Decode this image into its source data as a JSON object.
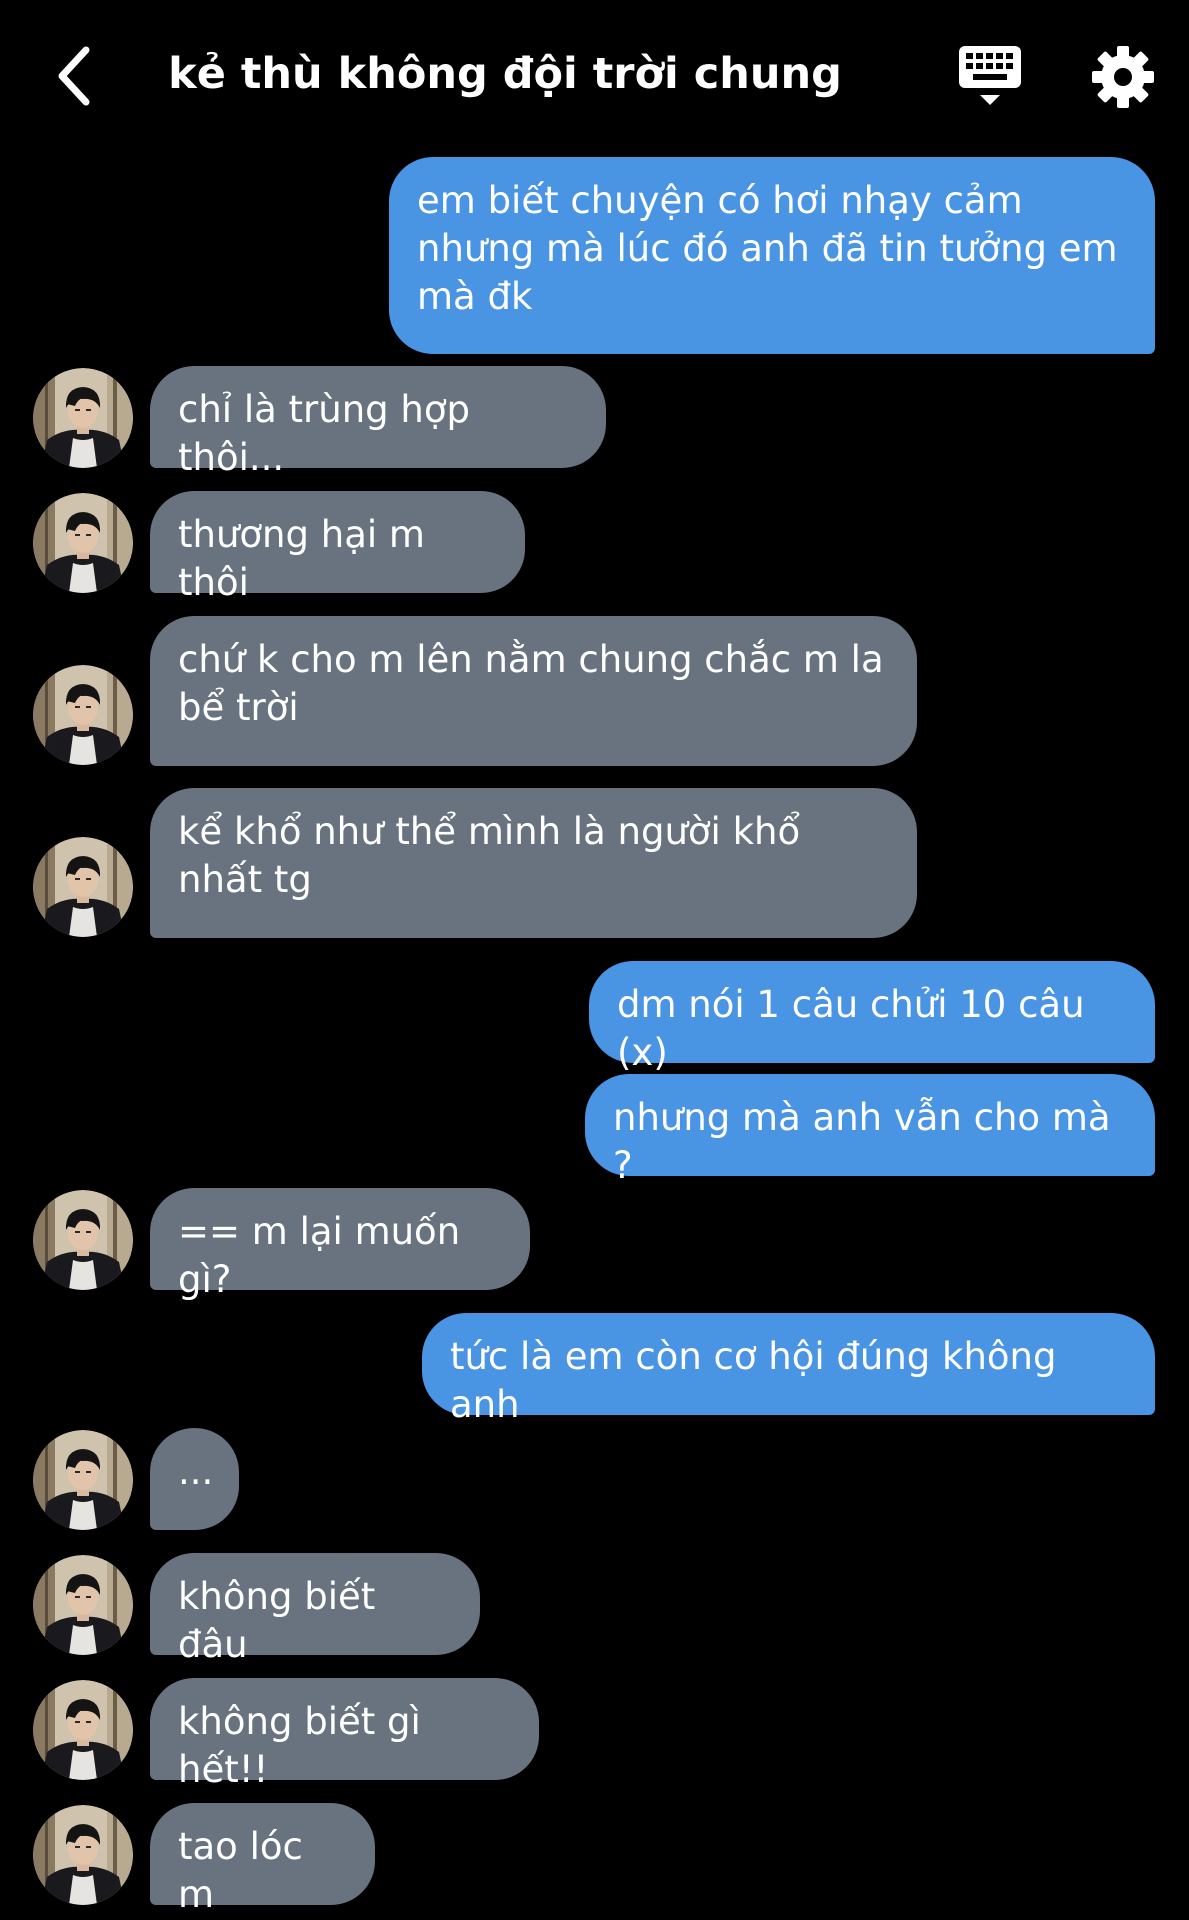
{
  "header": {
    "title": "kẻ thù không đội trời chung",
    "back_icon": "chevron-left-icon",
    "keyboard_icon": "keyboard-icon",
    "settings_icon": "gear-icon"
  },
  "colors": {
    "background": "#000000",
    "outgoing_bubble": "#4a94e4",
    "incoming_bubble": "#68737f",
    "text": "#ffffff"
  },
  "messages": [
    {
      "sender": "me",
      "text": "em biết chuyện có hơi nhạy cảm nhưng mà lúc đó anh đã tin tưởng em mà đk"
    },
    {
      "sender": "them",
      "text": "chỉ là trùng hợp thôi..."
    },
    {
      "sender": "them",
      "text": "thương hại m thôi"
    },
    {
      "sender": "them",
      "text": "chứ k cho m lên nằm chung chắc m la bể trời"
    },
    {
      "sender": "them",
      "text": "kể khổ như thể mình là người khổ nhất tg"
    },
    {
      "sender": "me",
      "text": "dm nói 1 câu chửi 10 câu (x)"
    },
    {
      "sender": "me",
      "text": "nhưng mà anh vẫn cho mà ?"
    },
    {
      "sender": "them",
      "text": "== m lại muốn gì?"
    },
    {
      "sender": "me",
      "text": "tức là em còn cơ hội đúng không anh"
    },
    {
      "sender": "them",
      "text": "..."
    },
    {
      "sender": "them",
      "text": "không biết đâu"
    },
    {
      "sender": "them",
      "text": "không biết gì hết!!"
    },
    {
      "sender": "them",
      "text": "tao lóc m"
    }
  ]
}
